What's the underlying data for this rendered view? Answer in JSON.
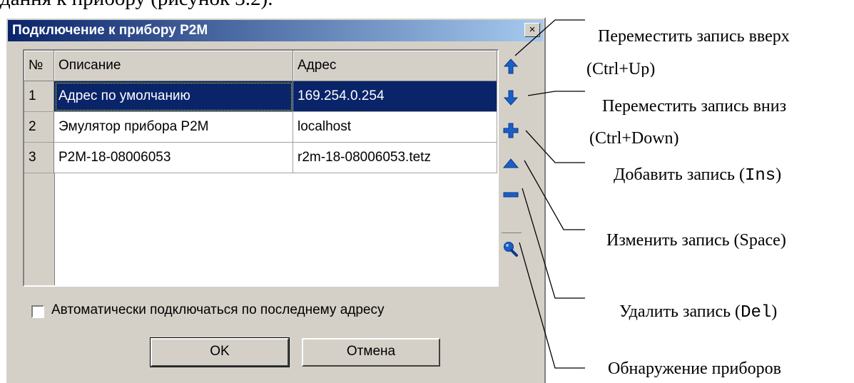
{
  "document_text": "дання к прибору (рисунок 3.2).",
  "dialog": {
    "title": "Подключение к прибору P2M",
    "close_label": "×"
  },
  "table": {
    "headers": [
      "№",
      "Описание",
      "Адрес"
    ],
    "rows": [
      {
        "num": "1",
        "desc": "Адрес по умолчанию",
        "addr": "169.254.0.254",
        "selected": true
      },
      {
        "num": "2",
        "desc": "Эмулятор прибора P2M",
        "addr": "localhost",
        "selected": false
      },
      {
        "num": "3",
        "desc": "P2M-18-08006053",
        "addr": "r2m-18-08006053.tetz",
        "selected": false
      }
    ]
  },
  "toolbar": {
    "icons": [
      "arrow-up-icon",
      "arrow-down-icon",
      "plus-icon",
      "triangle-up-icon",
      "minus-icon",
      "magnifier-icon"
    ],
    "icon_color": "#1a5fc8"
  },
  "auto_connect": {
    "label": "Автоматически подключаться по последнему адресу",
    "checked": false
  },
  "buttons": {
    "ok": "OK",
    "cancel": "Отмена"
  },
  "annotations": {
    "move_up_line1": "Переместить запись вверх",
    "move_up_line2": "(Ctrl+Up)",
    "move_down_line1": "Переместить запись вниз",
    "move_down_line2": "(Ctrl+Down)",
    "add_text": "Добавить запись (",
    "add_key": "Ins",
    "add_close": ")",
    "edit": "Изменить запись (Space)",
    "delete_text": "Удалить запись (",
    "delete_key": "Del",
    "delete_close": ")",
    "discover": "Обнаружение приборов"
  }
}
